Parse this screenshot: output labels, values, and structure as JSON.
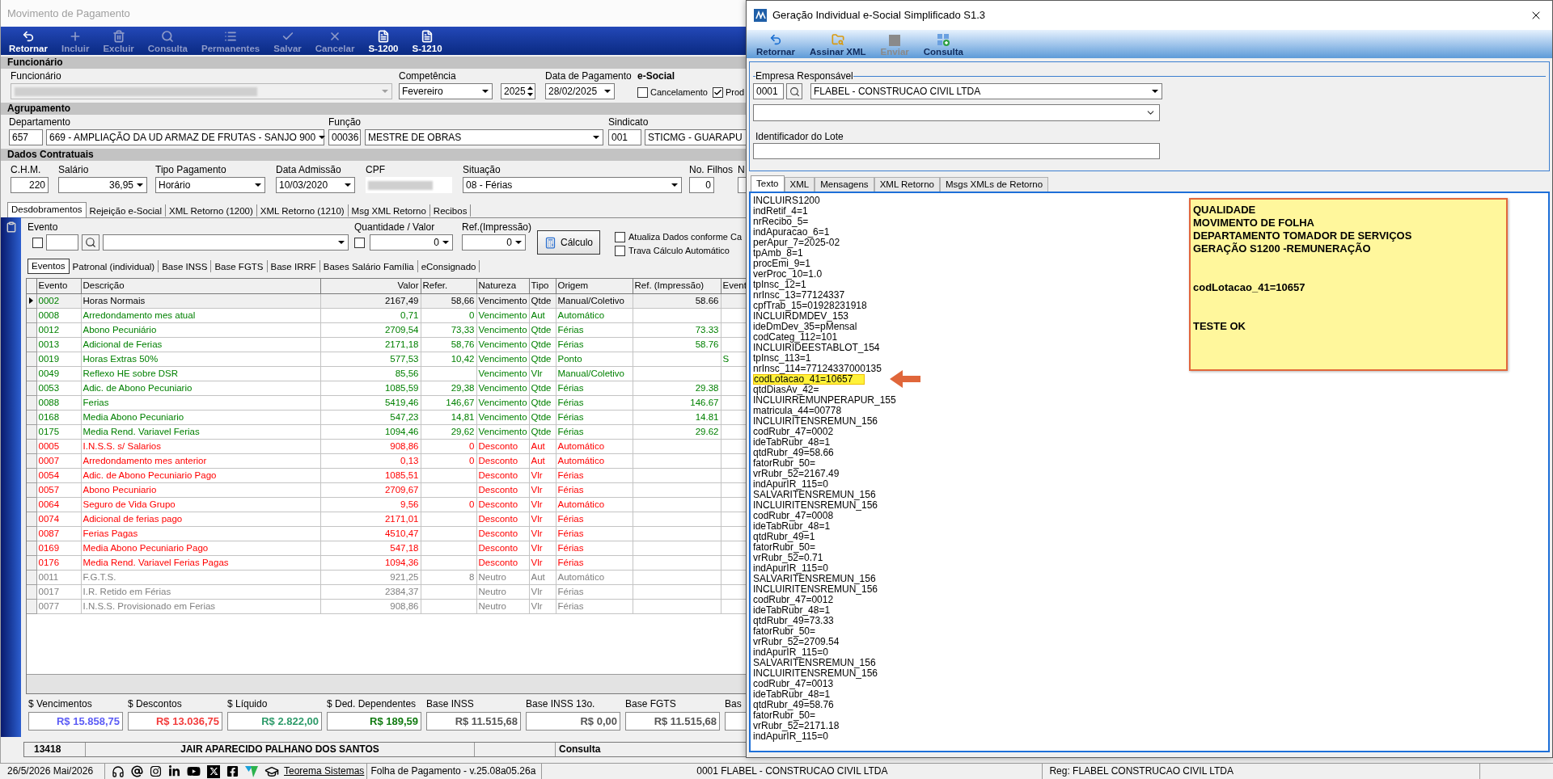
{
  "movimento_window": {
    "title": "Movimento de Pagamento",
    "toolbar": [
      {
        "label": "Retornar",
        "disabled": false
      },
      {
        "label": "Incluir",
        "disabled": true
      },
      {
        "label": "Excluir",
        "disabled": true
      },
      {
        "label": "Consulta",
        "disabled": true
      },
      {
        "label": "Permanentes",
        "disabled": true
      },
      {
        "label": "Salvar",
        "disabled": true
      },
      {
        "label": "Cancelar",
        "disabled": true
      },
      {
        "label": "S-1200",
        "disabled": false
      },
      {
        "label": "S-1210",
        "disabled": false
      }
    ],
    "funcionario": {
      "heading": "Funcionário",
      "funcionario_label": "Funcionário",
      "competencia_label": "Competência",
      "competencia": "Fevereiro",
      "ano": "2025",
      "data_pagamento_label": "Data de Pagamento",
      "data_pagamento": "28/02/2025",
      "esocial_label": "e-Social",
      "esocial_options": [
        {
          "label": "Cancelamento",
          "checked": false
        },
        {
          "label": "Prod",
          "checked": true
        }
      ]
    },
    "agrupamento": {
      "heading": "Agrupamento",
      "departamento_label": "Departamento",
      "departamento_codigo": "657",
      "departamento": "669 - AMPLIAÇÃO DA UD ARMAZ DE FRUTAS - SANJO 900",
      "funcao_label": "Função",
      "funcao_codigo": "00036",
      "funcao": "MESTRE DE OBRAS",
      "sindicato_label": "Sindicato",
      "sindicato_codigo": "001",
      "sindicato": "STICMG - GUARAPU"
    },
    "dados_contratuais": {
      "heading": "Dados Contratuais",
      "chm_label": "C.H.M.",
      "chm": "220",
      "salario_label": "Salário",
      "salario": "36,95",
      "tipo_pagamento_label": "Tipo Pagamento",
      "tipo_pagamento": "Horário",
      "data_admissao_label": "Data Admissão",
      "data_admissao": "10/03/2020",
      "cpf_label": "CPF",
      "situacao_label": "Situação",
      "situacao": "08 - Férias",
      "filhos_label": "No. Filhos",
      "filhos": "0",
      "column_9_label": "N"
    },
    "tabs": [
      {
        "label": "Desdobramentos",
        "selected": true
      },
      {
        "label": "Rejeição e-Social",
        "selected": false
      },
      {
        "label": "XML Retorno (1200)",
        "selected": false
      },
      {
        "label": "XML Retorno (1210)",
        "selected": false
      },
      {
        "label": "Msg XML Retorno",
        "selected": false
      },
      {
        "label": "Recibos",
        "selected": false
      }
    ],
    "evento_panel": {
      "evento_label": "Evento",
      "evento_checked": false,
      "quantidade_label": "Quantidade / Valor",
      "quantidade_checked": false,
      "quantidade": "0",
      "ref_label": "Ref.(Impressão)",
      "ref": "0",
      "calculo_button": "Cálculo",
      "options": [
        {
          "label": "Atualiza Dados conforme Ca",
          "checked": false
        },
        {
          "label": "Trava Cálculo Automático",
          "checked": false
        }
      ]
    },
    "subtabs": [
      {
        "label": "Eventos",
        "selected": true
      },
      {
        "label": "Patronal (individual)",
        "selected": false
      },
      {
        "label": "Base INSS",
        "selected": false
      },
      {
        "label": "Base FGTS",
        "selected": false
      },
      {
        "label": "Base IRRF",
        "selected": false
      },
      {
        "label": "Bases Salário Família",
        "selected": false
      },
      {
        "label": "eConsignado",
        "selected": false
      }
    ],
    "table": {
      "columns": [
        "Evento",
        "Descrição",
        "Valor",
        "Refer.",
        "Natureza",
        "Tipo",
        "Origem",
        "Ref. (Impressão)",
        "Event"
      ],
      "rows": [
        {
          "kind": "vencimento",
          "selected": true,
          "evento": "0002",
          "descricao": "Horas Normais",
          "valor": "2167,49",
          "refer": "58,66",
          "natureza": "Vencimento",
          "tipo": "Qtde",
          "origem": "Manual/Coletivo",
          "ref_impressao": "58.66"
        },
        {
          "kind": "vencimento",
          "selected": false,
          "evento": "0008",
          "descricao": "Arredondamento mes atual",
          "valor": "0,71",
          "refer": "0",
          "natureza": "Vencimento",
          "tipo": "Aut",
          "origem": "Automático"
        },
        {
          "kind": "vencimento",
          "selected": false,
          "evento": "0012",
          "descricao": "Abono Pecuniário",
          "valor": "2709,54",
          "refer": "73,33",
          "natureza": "Vencimento",
          "tipo": "Qtde",
          "origem": "Férias",
          "ref_impressao": "73.33"
        },
        {
          "kind": "vencimento",
          "selected": false,
          "evento": "0013",
          "descricao": "Adicional de Ferias",
          "valor": "2171,18",
          "refer": "58,76",
          "natureza": "Vencimento",
          "tipo": "Qtde",
          "origem": "Férias",
          "ref_impressao": "58.76"
        },
        {
          "kind": "vencimento",
          "selected": false,
          "evento": "0019",
          "descricao": "Horas Extras 50%",
          "valor": "577,53",
          "refer": "10,42",
          "natureza": "Vencimento",
          "tipo": "Qtde",
          "origem": "Ponto",
          "column_9": "S"
        },
        {
          "kind": "vencimento",
          "selected": false,
          "evento": "0049",
          "descricao": "Reflexo HE sobre DSR",
          "valor": "85,56",
          "natureza": "Vencimento",
          "tipo": "Vlr",
          "origem": "Manual/Coletivo"
        },
        {
          "kind": "vencimento",
          "selected": false,
          "evento": "0053",
          "descricao": "Adic. de Abono Pecuniario",
          "valor": "1085,59",
          "refer": "29,38",
          "natureza": "Vencimento",
          "tipo": "Qtde",
          "origem": "Férias",
          "ref_impressao": "29.38"
        },
        {
          "kind": "vencimento",
          "selected": false,
          "evento": "0088",
          "descricao": "Ferias",
          "valor": "5419,46",
          "refer": "146,67",
          "natureza": "Vencimento",
          "tipo": "Qtde",
          "origem": "Férias",
          "ref_impressao": "146.67"
        },
        {
          "kind": "vencimento",
          "selected": false,
          "evento": "0168",
          "descricao": "Media Abono Pecuniario",
          "valor": "547,23",
          "refer": "14,81",
          "natureza": "Vencimento",
          "tipo": "Qtde",
          "origem": "Férias",
          "ref_impressao": "14.81"
        },
        {
          "kind": "vencimento",
          "selected": false,
          "evento": "0175",
          "descricao": "Media Rend. Variavel Ferias",
          "valor": "1094,46",
          "refer": "29,62",
          "natureza": "Vencimento",
          "tipo": "Qtde",
          "origem": "Férias",
          "ref_impressao": "29.62"
        },
        {
          "kind": "desconto",
          "selected": false,
          "evento": "0005",
          "descricao": "I.N.S.S. s/ Salarios",
          "valor": "908,86",
          "refer": "0",
          "natureza": "Desconto",
          "tipo": "Aut",
          "origem": "Automático"
        },
        {
          "kind": "desconto",
          "selected": false,
          "evento": "0007",
          "descricao": "Arredondamento mes anterior",
          "valor": "0,13",
          "refer": "0",
          "natureza": "Desconto",
          "tipo": "Aut",
          "origem": "Automático"
        },
        {
          "kind": "desconto",
          "selected": false,
          "evento": "0054",
          "descricao": "Adic. de Abono Pecuniario Pago",
          "valor": "1085,51",
          "natureza": "Desconto",
          "tipo": "Vlr",
          "origem": "Férias"
        },
        {
          "kind": "desconto",
          "selected": false,
          "evento": "0057",
          "descricao": "Abono Pecuniario",
          "valor": "2709,67",
          "natureza": "Desconto",
          "tipo": "Vlr",
          "origem": "Férias"
        },
        {
          "kind": "desconto",
          "selected": false,
          "evento": "0064",
          "descricao": "Seguro de Vida Grupo",
          "valor": "9,56",
          "refer": "0",
          "natureza": "Desconto",
          "tipo": "Vlr",
          "origem": "Automático"
        },
        {
          "kind": "desconto",
          "selected": false,
          "evento": "0074",
          "descricao": "Adicional de ferias pago",
          "valor": "2171,01",
          "natureza": "Desconto",
          "tipo": "Vlr",
          "origem": "Férias"
        },
        {
          "kind": "desconto",
          "selected": false,
          "evento": "0087",
          "descricao": "Ferias Pagas",
          "valor": "4510,47",
          "natureza": "Desconto",
          "tipo": "Vlr",
          "origem": "Férias"
        },
        {
          "kind": "desconto",
          "selected": false,
          "evento": "0169",
          "descricao": "Media Abono Pecuniario Pago",
          "valor": "547,18",
          "natureza": "Desconto",
          "tipo": "Vlr",
          "origem": "Férias"
        },
        {
          "kind": "desconto",
          "selected": false,
          "evento": "0176",
          "descricao": "Media Rend. Variavel Ferias Pagas",
          "valor": "1094,36",
          "natureza": "Desconto",
          "tipo": "Vlr",
          "origem": "Férias"
        },
        {
          "kind": "neutro",
          "selected": false,
          "evento": "0011",
          "descricao": "F.G.T.S.",
          "valor": "921,25",
          "refer": "8",
          "natureza": "Neutro",
          "tipo": "Aut",
          "origem": "Automático"
        },
        {
          "kind": "neutro",
          "selected": false,
          "evento": "0017",
          "descricao": "I.R. Retido em Férias",
          "valor": "2384,37",
          "natureza": "Neutro",
          "tipo": "Vlr",
          "origem": "Férias"
        },
        {
          "kind": "neutro",
          "selected": false,
          "evento": "0077",
          "descricao": "I.N.S.S. Provisionado em Ferias",
          "valor": "908,86",
          "natureza": "Neutro",
          "tipo": "Vlr",
          "origem": "Férias"
        }
      ]
    },
    "totals": [
      {
        "label": "$ Vencimentos",
        "value": "R$ 15.858,75",
        "color": "#5b5bf5"
      },
      {
        "label": "$ Descontos",
        "value": "R$ 13.036,75",
        "color": "#f23c3c"
      },
      {
        "label": "$ Líquido",
        "value": "R$ 2.822,00",
        "color": "#2e9b6a"
      },
      {
        "label": "$ Ded. Dependentes",
        "value": "R$ 189,59",
        "color": "#107a10"
      },
      {
        "label": "Base INSS",
        "value": "R$ 11.515,68",
        "color": "#555555"
      },
      {
        "label": "Base INSS 13o.",
        "value": "R$ 0,00",
        "color": "#555555"
      },
      {
        "label": "Base FGTS",
        "value": "R$ 11.515,68",
        "color": "#555555"
      },
      {
        "label": "Bas"
      }
    ],
    "employee_bar": {
      "code": "13418",
      "name": "JAIR APARECIDO PALHANO DOS SANTOS",
      "mode": "Consulta"
    }
  },
  "geracao_window": {
    "title": "Geração Individual e-Social Simplificado S1.3",
    "toolbar": [
      {
        "label": "Retornar",
        "disabled": false
      },
      {
        "label": "Assinar XML",
        "disabled": false
      },
      {
        "label": "Enviar",
        "disabled": true
      },
      {
        "label": "Consulta",
        "disabled": false
      }
    ],
    "empresa": {
      "legend": "Empresa Responsável",
      "codigo": "0001",
      "nome": "FLABEL - CONSTRUCAO CIVIL LTDA"
    },
    "lote_label": "Identificador do Lote",
    "tabs": [
      {
        "label": "Texto",
        "selected": true
      },
      {
        "label": "XML",
        "selected": false
      },
      {
        "label": "Mensagens",
        "selected": false
      },
      {
        "label": "XML Retorno",
        "selected": false
      },
      {
        "label": "Msgs XMLs de Retorno",
        "selected": false
      }
    ],
    "text_lines": [
      {
        "text": "INCLUIRS1200",
        "highlighted": false
      },
      {
        "text": "indRetif_4=1",
        "highlighted": false
      },
      {
        "text": "nrRecibo_5=",
        "highlighted": false
      },
      {
        "text": "indApuracao_6=1",
        "highlighted": false
      },
      {
        "text": "perApur_7=2025-02",
        "highlighted": false
      },
      {
        "text": "tpAmb_8=1",
        "highlighted": false
      },
      {
        "text": "procEmi_9=1",
        "highlighted": false
      },
      {
        "text": "verProc_10=1.0",
        "highlighted": false
      },
      {
        "text": "tpInsc_12=1",
        "highlighted": false
      },
      {
        "text": "nrInsc_13=77124337",
        "highlighted": false
      },
      {
        "text": "cpfTrab_15=01928231918",
        "highlighted": false
      },
      {
        "text": "INCLUIRDMDEV_153",
        "highlighted": false
      },
      {
        "text": "ideDmDev_35=pMensal",
        "highlighted": false
      },
      {
        "text": "codCateg_112=101",
        "highlighted": false
      },
      {
        "text": "INCLUIRIDEESTABLOT_154",
        "highlighted": false
      },
      {
        "text": "tpInsc_113=1",
        "highlighted": false
      },
      {
        "text": "nrInsc_114=77124337000135",
        "highlighted": false
      },
      {
        "text": "codLotacao_41=10657",
        "highlighted": true
      },
      {
        "text": "qtdDiasAv_42=",
        "highlighted": false
      },
      {
        "text": "INCLUIRREMUNPERAPUR_155",
        "highlighted": false
      },
      {
        "text": "matricula_44=00778",
        "highlighted": false
      },
      {
        "text": "INCLUIRITENSREMUN_156",
        "highlighted": false
      },
      {
        "text": "codRubr_47=0002",
        "highlighted": false
      },
      {
        "text": "ideTabRubr_48=1",
        "highlighted": false
      },
      {
        "text": "qtdRubr_49=58.66",
        "highlighted": false
      },
      {
        "text": "fatorRubr_50=",
        "highlighted": false
      },
      {
        "text": "vrRubr_52=2167.49",
        "highlighted": false
      },
      {
        "text": "indApurIR_115=0",
        "highlighted": false
      },
      {
        "text": "SALVARITENSREMUN_156",
        "highlighted": false
      },
      {
        "text": "INCLUIRITENSREMUN_156",
        "highlighted": false
      },
      {
        "text": "codRubr_47=0008",
        "highlighted": false
      },
      {
        "text": "ideTabRubr_48=1",
        "highlighted": false
      },
      {
        "text": "qtdRubr_49=1",
        "highlighted": false
      },
      {
        "text": "fatorRubr_50=",
        "highlighted": false
      },
      {
        "text": "vrRubr_52=0.71",
        "highlighted": false
      },
      {
        "text": "indApurIR_115=0",
        "highlighted": false
      },
      {
        "text": "SALVARITENSREMUN_156",
        "highlighted": false
      },
      {
        "text": "INCLUIRITENSREMUN_156",
        "highlighted": false
      },
      {
        "text": "codRubr_47=0012",
        "highlighted": false
      },
      {
        "text": "ideTabRubr_48=1",
        "highlighted": false
      },
      {
        "text": "qtdRubr_49=73.33",
        "highlighted": false
      },
      {
        "text": "fatorRubr_50=",
        "highlighted": false
      },
      {
        "text": "vrRubr_52=2709.54",
        "highlighted": false
      },
      {
        "text": "indApurIR_115=0",
        "highlighted": false
      },
      {
        "text": "SALVARITENSREMUN_156",
        "highlighted": false
      },
      {
        "text": "INCLUIRITENSREMUN_156",
        "highlighted": false
      },
      {
        "text": "codRubr_47=0013",
        "highlighted": false
      },
      {
        "text": "ideTabRubr_48=1",
        "highlighted": false
      },
      {
        "text": "qtdRubr_49=58.76",
        "highlighted": false
      },
      {
        "text": "fatorRubr_50=",
        "highlighted": false
      },
      {
        "text": "vrRubr_52=2171.18",
        "highlighted": false
      },
      {
        "text": "indApurIR_115=0",
        "highlighted": false
      }
    ],
    "note": {
      "paragraphs": [
        [
          "QUALIDADE",
          "MOVIMENTO DE FOLHA",
          "DEPARTAMENTO TOMADOR DE SERVIÇOS",
          "GERAÇÃO S1200 -REMUNERAÇÃO"
        ],
        [
          "codLotacao_41=10657"
        ],
        [
          "TESTE OK"
        ]
      ]
    }
  },
  "status_bar": {
    "date": "26/5/2026 Mai/2026",
    "link": "Teorema Sistemas",
    "product": "Folha de Pagamento - v.25.08a05.26a",
    "company": "0001 FLABEL - CONSTRUCAO CIVIL LTDA",
    "registration": "Reg: FLABEL CONSTRUCAO CIVIL LTDA"
  }
}
